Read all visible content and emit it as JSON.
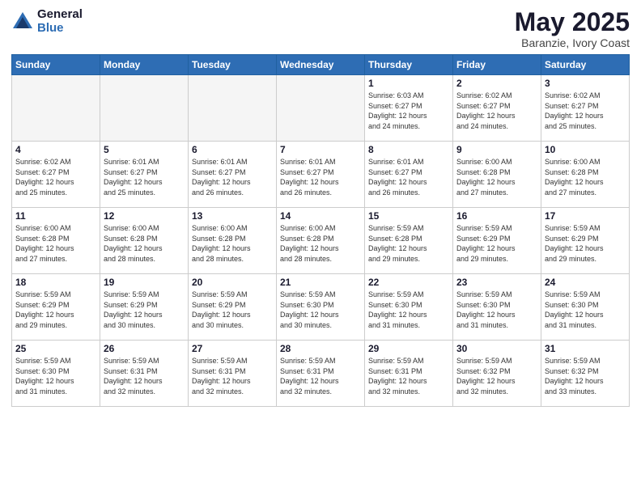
{
  "logo": {
    "general": "General",
    "blue": "Blue"
  },
  "header": {
    "month_year": "May 2025",
    "location": "Baranzie, Ivory Coast"
  },
  "days_of_week": [
    "Sunday",
    "Monday",
    "Tuesday",
    "Wednesday",
    "Thursday",
    "Friday",
    "Saturday"
  ],
  "weeks": [
    [
      {
        "day": "",
        "info": ""
      },
      {
        "day": "",
        "info": ""
      },
      {
        "day": "",
        "info": ""
      },
      {
        "day": "",
        "info": ""
      },
      {
        "day": "1",
        "info": "Sunrise: 6:03 AM\nSunset: 6:27 PM\nDaylight: 12 hours\nand 24 minutes."
      },
      {
        "day": "2",
        "info": "Sunrise: 6:02 AM\nSunset: 6:27 PM\nDaylight: 12 hours\nand 24 minutes."
      },
      {
        "day": "3",
        "info": "Sunrise: 6:02 AM\nSunset: 6:27 PM\nDaylight: 12 hours\nand 25 minutes."
      }
    ],
    [
      {
        "day": "4",
        "info": "Sunrise: 6:02 AM\nSunset: 6:27 PM\nDaylight: 12 hours\nand 25 minutes."
      },
      {
        "day": "5",
        "info": "Sunrise: 6:01 AM\nSunset: 6:27 PM\nDaylight: 12 hours\nand 25 minutes."
      },
      {
        "day": "6",
        "info": "Sunrise: 6:01 AM\nSunset: 6:27 PM\nDaylight: 12 hours\nand 26 minutes."
      },
      {
        "day": "7",
        "info": "Sunrise: 6:01 AM\nSunset: 6:27 PM\nDaylight: 12 hours\nand 26 minutes."
      },
      {
        "day": "8",
        "info": "Sunrise: 6:01 AM\nSunset: 6:27 PM\nDaylight: 12 hours\nand 26 minutes."
      },
      {
        "day": "9",
        "info": "Sunrise: 6:00 AM\nSunset: 6:28 PM\nDaylight: 12 hours\nand 27 minutes."
      },
      {
        "day": "10",
        "info": "Sunrise: 6:00 AM\nSunset: 6:28 PM\nDaylight: 12 hours\nand 27 minutes."
      }
    ],
    [
      {
        "day": "11",
        "info": "Sunrise: 6:00 AM\nSunset: 6:28 PM\nDaylight: 12 hours\nand 27 minutes."
      },
      {
        "day": "12",
        "info": "Sunrise: 6:00 AM\nSunset: 6:28 PM\nDaylight: 12 hours\nand 28 minutes."
      },
      {
        "day": "13",
        "info": "Sunrise: 6:00 AM\nSunset: 6:28 PM\nDaylight: 12 hours\nand 28 minutes."
      },
      {
        "day": "14",
        "info": "Sunrise: 6:00 AM\nSunset: 6:28 PM\nDaylight: 12 hours\nand 28 minutes."
      },
      {
        "day": "15",
        "info": "Sunrise: 5:59 AM\nSunset: 6:28 PM\nDaylight: 12 hours\nand 29 minutes."
      },
      {
        "day": "16",
        "info": "Sunrise: 5:59 AM\nSunset: 6:29 PM\nDaylight: 12 hours\nand 29 minutes."
      },
      {
        "day": "17",
        "info": "Sunrise: 5:59 AM\nSunset: 6:29 PM\nDaylight: 12 hours\nand 29 minutes."
      }
    ],
    [
      {
        "day": "18",
        "info": "Sunrise: 5:59 AM\nSunset: 6:29 PM\nDaylight: 12 hours\nand 29 minutes."
      },
      {
        "day": "19",
        "info": "Sunrise: 5:59 AM\nSunset: 6:29 PM\nDaylight: 12 hours\nand 30 minutes."
      },
      {
        "day": "20",
        "info": "Sunrise: 5:59 AM\nSunset: 6:29 PM\nDaylight: 12 hours\nand 30 minutes."
      },
      {
        "day": "21",
        "info": "Sunrise: 5:59 AM\nSunset: 6:30 PM\nDaylight: 12 hours\nand 30 minutes."
      },
      {
        "day": "22",
        "info": "Sunrise: 5:59 AM\nSunset: 6:30 PM\nDaylight: 12 hours\nand 31 minutes."
      },
      {
        "day": "23",
        "info": "Sunrise: 5:59 AM\nSunset: 6:30 PM\nDaylight: 12 hours\nand 31 minutes."
      },
      {
        "day": "24",
        "info": "Sunrise: 5:59 AM\nSunset: 6:30 PM\nDaylight: 12 hours\nand 31 minutes."
      }
    ],
    [
      {
        "day": "25",
        "info": "Sunrise: 5:59 AM\nSunset: 6:30 PM\nDaylight: 12 hours\nand 31 minutes."
      },
      {
        "day": "26",
        "info": "Sunrise: 5:59 AM\nSunset: 6:31 PM\nDaylight: 12 hours\nand 32 minutes."
      },
      {
        "day": "27",
        "info": "Sunrise: 5:59 AM\nSunset: 6:31 PM\nDaylight: 12 hours\nand 32 minutes."
      },
      {
        "day": "28",
        "info": "Sunrise: 5:59 AM\nSunset: 6:31 PM\nDaylight: 12 hours\nand 32 minutes."
      },
      {
        "day": "29",
        "info": "Sunrise: 5:59 AM\nSunset: 6:31 PM\nDaylight: 12 hours\nand 32 minutes."
      },
      {
        "day": "30",
        "info": "Sunrise: 5:59 AM\nSunset: 6:32 PM\nDaylight: 12 hours\nand 32 minutes."
      },
      {
        "day": "31",
        "info": "Sunrise: 5:59 AM\nSunset: 6:32 PM\nDaylight: 12 hours\nand 33 minutes."
      }
    ]
  ]
}
